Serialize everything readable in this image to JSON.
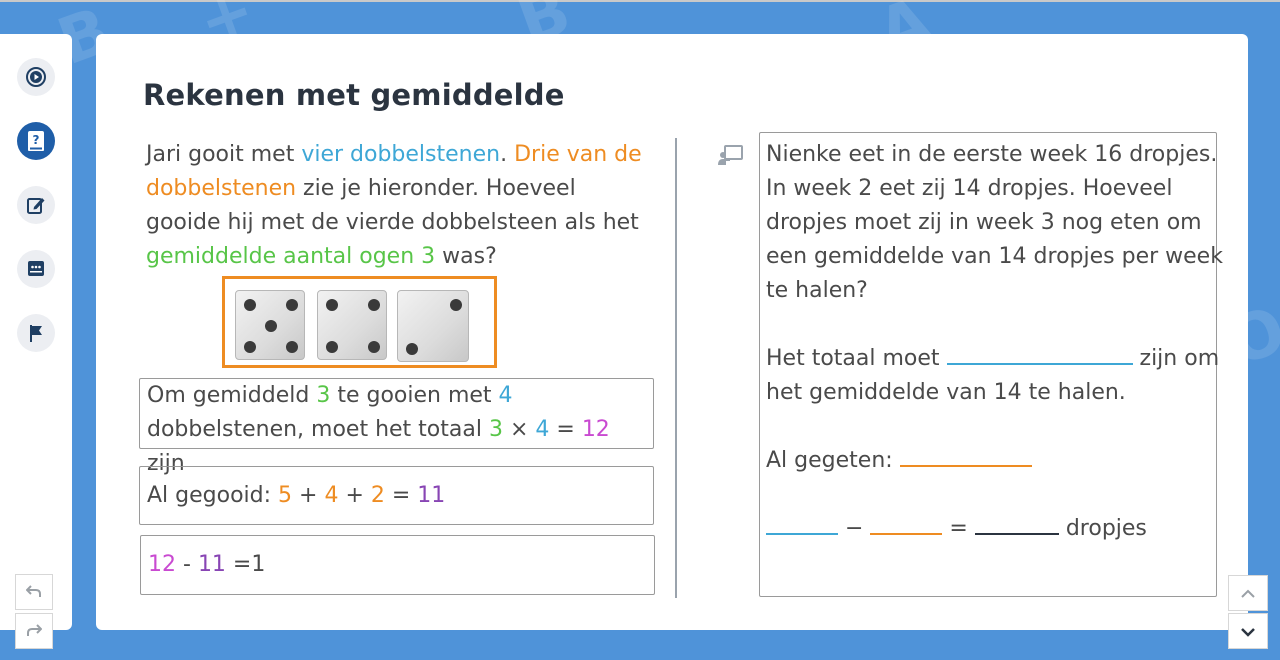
{
  "page": {
    "title": "Rekenen met gemiddelde"
  },
  "sidebar": {
    "items": [
      {
        "icon": "play-circle-icon",
        "active": false
      },
      {
        "icon": "question-book-icon",
        "active": true
      },
      {
        "icon": "edit-icon",
        "active": false
      },
      {
        "icon": "chat-icon",
        "active": false
      },
      {
        "icon": "flag-icon",
        "active": false
      }
    ]
  },
  "question": {
    "p1": "Jari gooit met ",
    "p2": "vier dobbelstenen",
    "p3": ". ",
    "p4": "Drie van de dobbelstenen",
    "p5": " zie je hieronder. Hoeveel gooide hij met de vierde dobbelsteen als het ",
    "p6": "gemiddelde aantal ogen 3",
    "p7": " was?"
  },
  "dice": [
    5,
    4,
    2
  ],
  "answer1": {
    "a": "Om gemiddeld ",
    "b": "3",
    "c": " te gooien met ",
    "d": "4",
    "e": "dobbelstenen, moet het totaal ",
    "f": "3",
    "g": " × ",
    "h": "4",
    "i": " = ",
    "j": "12",
    "k": " zijn"
  },
  "answer2": {
    "a": "Al gegooid: ",
    "b": "5",
    "c": " + ",
    "d": "4",
    "e": " + ",
    "f": "2",
    "g": " = ",
    "h": "11"
  },
  "answer3": {
    "a": "12",
    "b": " - ",
    "c": "11",
    "d": " =1"
  },
  "right": {
    "lines": [
      "Nienke eet in de eerste week 16 dropjes.",
      "In week 2 eet zij 14 dropjes. Hoeveel",
      "dropjes moet zij in week 3 nog eten om",
      "een gemiddelde van 14 dropjes per week",
      "te halen?"
    ],
    "total_a": "Het totaal moet ",
    "total_b": " zijn om",
    "total_c": "het gemiddelde van 14 te halen.",
    "eaten": "Al gegeten: ",
    "minus": " − ",
    "equals": " = ",
    "unit": " dropjes"
  },
  "colors": {
    "accent": "#1f5ea8",
    "orange": "#ee8c22",
    "blue": "#3ea7d6",
    "green": "#58c548",
    "magenta": "#c94ad1",
    "purple": "#8845b4",
    "background": "#4f93d9"
  }
}
